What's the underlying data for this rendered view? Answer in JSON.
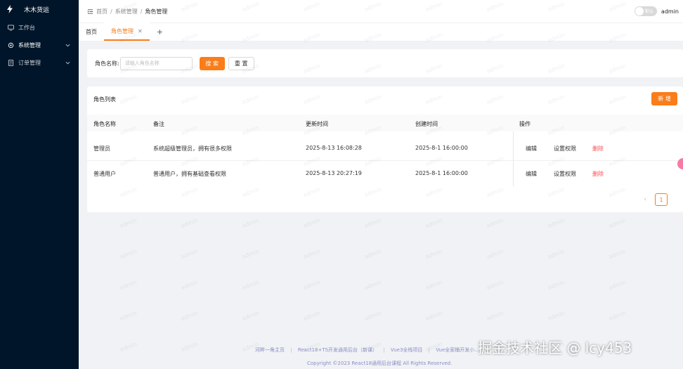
{
  "app": {
    "title": "木木货运"
  },
  "sidebar": {
    "items": [
      {
        "label": "工作台",
        "icon": "monitor-icon",
        "has_children": false,
        "active": false
      },
      {
        "label": "系统管理",
        "icon": "settings-icon",
        "has_children": true,
        "active": true
      },
      {
        "label": "订单管理",
        "icon": "order-icon",
        "has_children": true,
        "active": false
      }
    ]
  },
  "header": {
    "breadcrumb": [
      "首页",
      "系统管理",
      "角色管理"
    ],
    "theme_toggle_label": "默认",
    "username": "admin"
  },
  "tabs": [
    {
      "label": "首页",
      "active": false,
      "closable": false
    },
    {
      "label": "角色管理",
      "active": true,
      "closable": true
    }
  ],
  "tab_add_label": "+",
  "search": {
    "label": "角色名称:",
    "placeholder": "请输入角色名称",
    "search_button": "搜 索",
    "reset_button": "重 置"
  },
  "table": {
    "title": "角色列表",
    "new_button": "新 增",
    "columns": [
      "角色名称",
      "备注",
      "更新时间",
      "创建时间",
      "操作"
    ],
    "rows": [
      {
        "name": "管理员",
        "remark": "系统超级管理员，拥有很多权限",
        "updated": "2025-8-13 16:08:28",
        "created": "2025-8-1 16:00:00"
      },
      {
        "name": "普通用户",
        "remark": "普通用户，拥有基础查看权限",
        "updated": "2025-8-13 20:27:19",
        "created": "2025-8-1 16:00:00"
      }
    ],
    "actions": {
      "edit": "编辑",
      "permission": "设置权限",
      "delete": "删除"
    }
  },
  "pagination": {
    "prev": "‹",
    "current_page": "1"
  },
  "footer": {
    "links": [
      "河畔一角主页",
      "React18+TS开发通用后台（新课）",
      "Vue3全栈项目",
      "Vue全家桶开发小..."
    ],
    "copyright": "Copyright ©2023 React18通用后台课程 All Rights Reserved."
  },
  "overlay_watermark": "掘金技术社区 @ lcy453",
  "background_watermark": "admin",
  "colors": {
    "primary": "#fa7d19",
    "sidebar_bg": "#001529",
    "danger": "#ff4d4f",
    "page_bg": "#f0f2f5"
  }
}
